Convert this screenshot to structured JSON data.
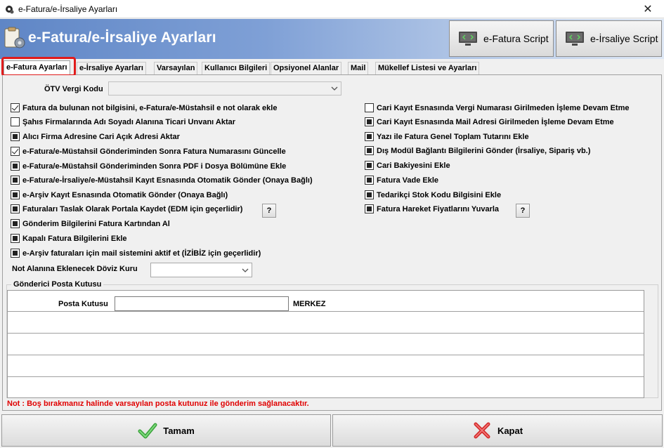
{
  "window": {
    "title": "e-Fatura/e-İrsaliye Ayarları"
  },
  "banner": {
    "title": "e-Fatura/e-İrsaliye Ayarları"
  },
  "header_buttons": {
    "efatura_script": "e-Fatura Script",
    "eirsaliye_script": "e-İrsaliye Script"
  },
  "tabs": [
    {
      "label": "e-Fatura Ayarları"
    },
    {
      "label": "e-İrsaliye Ayarları"
    },
    {
      "label": "Varsayılan"
    },
    {
      "label": "Kullanıcı Bilgileri"
    },
    {
      "label": "Opsiyonel Alanlar"
    },
    {
      "label": "Mail"
    },
    {
      "label": "Mükellef Listesi ve Ayarları"
    }
  ],
  "otv": {
    "label": "ÖTV Vergi Kodu",
    "value": ""
  },
  "left_checks": [
    {
      "label": "Fatura da bulunan not bilgisini, e-Fatura/e-Müstahsil e not olarak ekle",
      "state": "checked"
    },
    {
      "label": "Şahıs Firmalarında Adı Soyadı Alanına Ticari Unvanı Aktar",
      "state": "unchecked"
    },
    {
      "label": "Alıcı Firma Adresine Cari Açık Adresi Aktar",
      "state": "indeterminate"
    },
    {
      "label": "e-Fatura/e-Müstahsil Gönderiminden Sonra Fatura Numarasını Güncelle",
      "state": "checked"
    },
    {
      "label": "e-Fatura/e-Müstahsil Gönderiminden Sonra PDF i Dosya Bölümüne Ekle",
      "state": "indeterminate"
    },
    {
      "label": "e-Fatura/e-İrsaliye/e-Müstahsil Kayıt Esnasında Otomatik Gönder (Onaya Bağlı)",
      "state": "indeterminate"
    },
    {
      "label": "e-Arşiv Kayıt Esnasında Otomatik Gönder (Onaya Bağlı)",
      "state": "indeterminate"
    },
    {
      "label": "Faturaları Taslak Olarak Portala Kaydet (EDM için geçerlidir)",
      "state": "indeterminate"
    },
    {
      "label": "Gönderim Bilgilerini Fatura Kartından Al",
      "state": "indeterminate"
    },
    {
      "label": "Kapalı Fatura Bilgilerini Ekle",
      "state": "indeterminate"
    },
    {
      "label": "e-Arşiv faturaları için mail sistemini aktif et (İZİBİZ için geçerlidir)",
      "state": "indeterminate"
    }
  ],
  "right_checks": [
    {
      "label": "Cari Kayıt Esnasında Vergi Numarası Girilmeden İşleme Devam Etme",
      "state": "unchecked"
    },
    {
      "label": "Cari Kayıt Esnasında Mail Adresi Girilmeden İşleme Devam Etme",
      "state": "indeterminate"
    },
    {
      "label": "Yazı ile Fatura Genel Toplam Tutarını Ekle",
      "state": "indeterminate"
    },
    {
      "label": "Dış Modül Bağlantı Bilgilerini Gönder (İrsaliye, Sipariş vb.)",
      "state": "indeterminate"
    },
    {
      "label": "Cari Bakiyesini Ekle",
      "state": "indeterminate"
    },
    {
      "label": "Fatura Vade Ekle",
      "state": "indeterminate"
    },
    {
      "label": "Tedarikçi Stok Kodu Bilgisini Ekle",
      "state": "indeterminate"
    },
    {
      "label": "Fatura Hareket Fiyatlarını Yuvarla",
      "state": "indeterminate"
    }
  ],
  "help_label": "?",
  "doviz": {
    "label": "Not Alanına Eklenecek Döviz Kuru",
    "value": ""
  },
  "posta": {
    "group_title": "Gönderici Posta Kutusu",
    "label": "Posta Kutusu",
    "value": "",
    "suffix": "MERKEZ"
  },
  "note": "Not : Boş bırakmanız halinde varsayılan posta kutunuz ile gönderim sağlanacaktır.",
  "footer": {
    "ok_label": "Tamam",
    "close_label": "Kapat"
  }
}
